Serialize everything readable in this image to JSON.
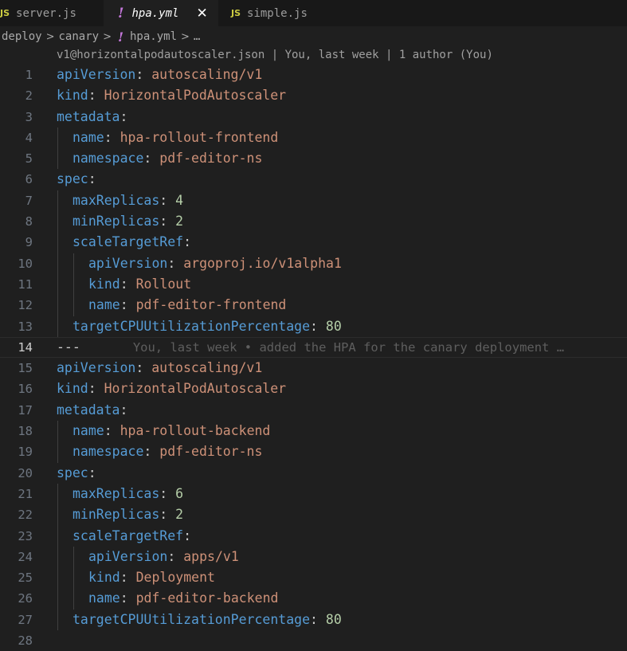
{
  "tabs": [
    {
      "icon": "JS",
      "label": "server.js",
      "active": false
    },
    {
      "icon": "!",
      "label": "hpa.yml",
      "active": true,
      "close": "✕"
    },
    {
      "icon": "JS",
      "label": "simple.js",
      "active": false
    }
  ],
  "breadcrumb": {
    "parts": [
      "deploy",
      "canary",
      "hpa.yml",
      "…"
    ],
    "yml_icon": "!"
  },
  "codelens": "v1@horizontalpodautoscaler.json | You, last week | 1 author (You)",
  "editor": {
    "current_line": 14,
    "blame": "You, last week • added the HPA for the canary deployment …",
    "lines": [
      {
        "n": "1",
        "indent": 0,
        "key": "apiVersion",
        "value": "autoscaling/v1",
        "vtype": "str"
      },
      {
        "n": "2",
        "indent": 0,
        "key": "kind",
        "value": "HorizontalPodAutoscaler",
        "vtype": "str"
      },
      {
        "n": "3",
        "indent": 0,
        "key": "metadata",
        "value": "",
        "vtype": "none"
      },
      {
        "n": "4",
        "indent": 1,
        "key": "name",
        "value": "hpa-rollout-frontend",
        "vtype": "str"
      },
      {
        "n": "5",
        "indent": 1,
        "key": "namespace",
        "value": "pdf-editor-ns",
        "vtype": "str"
      },
      {
        "n": "6",
        "indent": 0,
        "key": "spec",
        "value": "",
        "vtype": "none"
      },
      {
        "n": "7",
        "indent": 1,
        "key": "maxReplicas",
        "value": "4",
        "vtype": "num"
      },
      {
        "n": "8",
        "indent": 1,
        "key": "minReplicas",
        "value": "2",
        "vtype": "num"
      },
      {
        "n": "9",
        "indent": 1,
        "key": "scaleTargetRef",
        "value": "",
        "vtype": "none"
      },
      {
        "n": "10",
        "indent": 2,
        "key": "apiVersion",
        "value": "argoproj.io/v1alpha1",
        "vtype": "str"
      },
      {
        "n": "11",
        "indent": 2,
        "key": "kind",
        "value": "Rollout",
        "vtype": "str"
      },
      {
        "n": "12",
        "indent": 2,
        "key": "name",
        "value": "pdf-editor-frontend",
        "vtype": "str"
      },
      {
        "n": "13",
        "indent": 1,
        "key": "targetCPUUtilizationPercentage",
        "value": "80",
        "vtype": "num"
      },
      {
        "n": "14",
        "indent": 0,
        "doc": "---"
      },
      {
        "n": "15",
        "indent": 0,
        "key": "apiVersion",
        "value": "autoscaling/v1",
        "vtype": "str"
      },
      {
        "n": "16",
        "indent": 0,
        "key": "kind",
        "value": "HorizontalPodAutoscaler",
        "vtype": "str"
      },
      {
        "n": "17",
        "indent": 0,
        "key": "metadata",
        "value": "",
        "vtype": "none"
      },
      {
        "n": "18",
        "indent": 1,
        "key": "name",
        "value": "hpa-rollout-backend",
        "vtype": "str"
      },
      {
        "n": "19",
        "indent": 1,
        "key": "namespace",
        "value": "pdf-editor-ns",
        "vtype": "str"
      },
      {
        "n": "20",
        "indent": 0,
        "key": "spec",
        "value": "",
        "vtype": "none"
      },
      {
        "n": "21",
        "indent": 1,
        "key": "maxReplicas",
        "value": "6",
        "vtype": "num"
      },
      {
        "n": "22",
        "indent": 1,
        "key": "minReplicas",
        "value": "2",
        "vtype": "num"
      },
      {
        "n": "23",
        "indent": 1,
        "key": "scaleTargetRef",
        "value": "",
        "vtype": "none"
      },
      {
        "n": "24",
        "indent": 2,
        "key": "apiVersion",
        "value": "apps/v1",
        "vtype": "str"
      },
      {
        "n": "25",
        "indent": 2,
        "key": "kind",
        "value": "Deployment",
        "vtype": "str"
      },
      {
        "n": "26",
        "indent": 2,
        "key": "name",
        "value": "pdf-editor-backend",
        "vtype": "str"
      },
      {
        "n": "27",
        "indent": 1,
        "key": "targetCPUUtilizationPercentage",
        "value": "80",
        "vtype": "num"
      },
      {
        "n": "28",
        "indent": 0,
        "blank": true
      }
    ]
  },
  "colors": {
    "background": "#1f1f1f",
    "tabbar": "#181818",
    "key": "#569cd6",
    "string": "#ce9178",
    "number": "#b5cea8",
    "line_number": "#6e7681",
    "js_icon": "#cbcb41",
    "yaml_icon": "#c678dd"
  },
  "icons": {
    "js_file": "js-file-icon",
    "yaml_file": "yaml-exclamation-icon",
    "close": "close-icon",
    "separator": "chevron-right-icon"
  }
}
